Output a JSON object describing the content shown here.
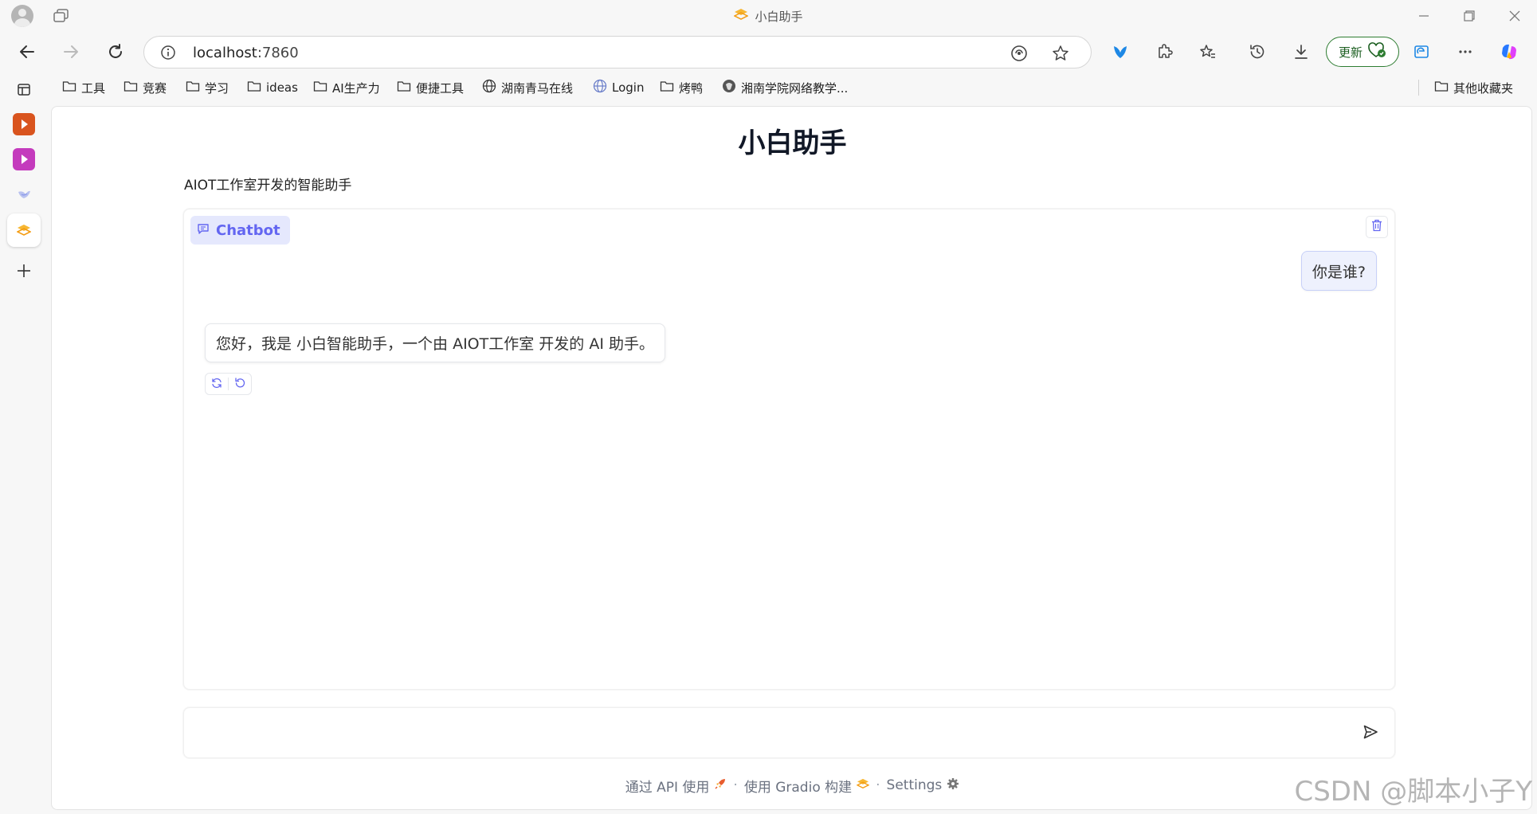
{
  "window": {
    "title": "小白助手",
    "controls": [
      "minimize",
      "restore",
      "close"
    ]
  },
  "navbar": {
    "url_host": "localhost",
    "url_port": ":7860",
    "update_label": "更新"
  },
  "bookmarks": [
    {
      "label": "工具",
      "icon": "folder-icon"
    },
    {
      "label": "竞赛",
      "icon": "folder-icon"
    },
    {
      "label": "学习",
      "icon": "folder-icon"
    },
    {
      "label": "ideas",
      "icon": "folder-icon"
    },
    {
      "label": "AI生产力",
      "icon": "folder-icon"
    },
    {
      "label": "便捷工具",
      "icon": "folder-icon"
    },
    {
      "label": "湖南青马在线",
      "icon": "globe-icon"
    },
    {
      "label": "Login",
      "icon": "globe-icon"
    },
    {
      "label": "烤鸭",
      "icon": "folder-icon"
    },
    {
      "label": "湘南学院网络教学...",
      "icon": "globe-icon"
    }
  ],
  "other_bookmarks": "其他收藏夹",
  "page": {
    "title": "小白助手",
    "description": "AIOT工作室开发的智能助手",
    "chatbot_label": "Chatbot",
    "messages": [
      {
        "role": "user",
        "text": "你是谁?"
      },
      {
        "role": "assistant",
        "text": "您好，我是 小白智能助手，一个由 AIOT工作室 开发的 AI 助手。"
      }
    ],
    "input_placeholder": "",
    "footer": {
      "api": "通过 API 使用",
      "built": "使用 Gradio 构建",
      "settings": "Settings"
    }
  },
  "watermark": "CSDN @脚本小子Y",
  "colors": {
    "accent": "#6366f1",
    "chatbot_label_bg": "#e5e8fd",
    "user_bubble_bg": "#eef1fd",
    "update_green": "#2e7d32"
  }
}
